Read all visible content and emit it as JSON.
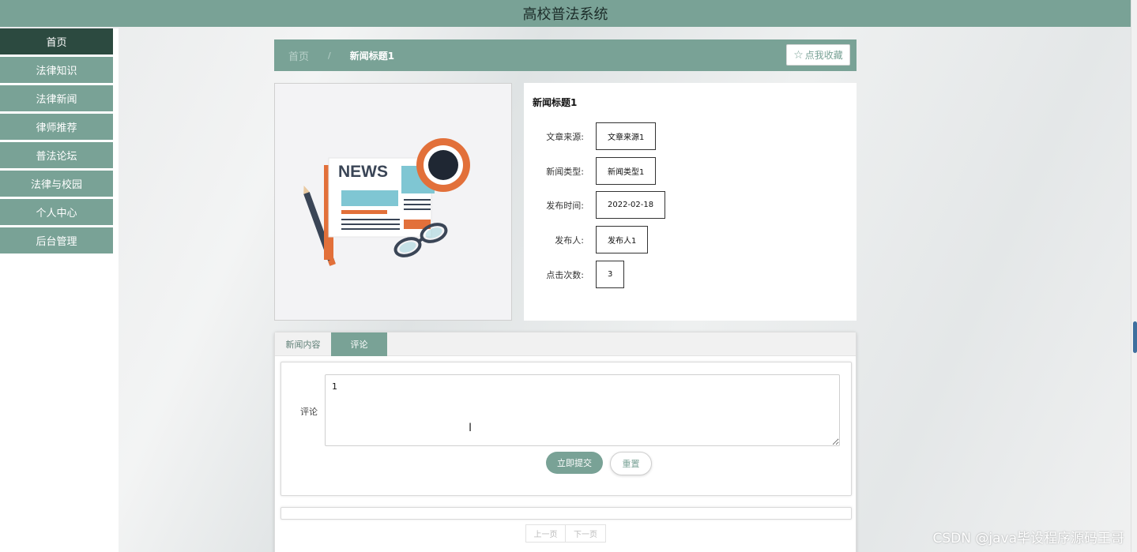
{
  "app": {
    "title": "高校普法系统"
  },
  "sidebar": {
    "items": [
      {
        "label": "首页"
      },
      {
        "label": "法律知识"
      },
      {
        "label": "法律新闻"
      },
      {
        "label": "律师推荐"
      },
      {
        "label": "普法论坛"
      },
      {
        "label": "法律与校园"
      },
      {
        "label": "个人中心"
      },
      {
        "label": "后台管理"
      }
    ]
  },
  "breadcrumb": {
    "home": "首页",
    "separator": "/",
    "current": "新闻标题1"
  },
  "favorite": {
    "icon": "star-outline-icon",
    "label": "点我收藏"
  },
  "image": {
    "headline_text": "NEWS"
  },
  "detail": {
    "title": "新闻标题1",
    "fields": [
      {
        "label": "文章来源:",
        "value": "文章来源1"
      },
      {
        "label": "新闻类型:",
        "value": "新闻类型1"
      },
      {
        "label": "发布时间:",
        "value": "2022-02-18"
      },
      {
        "label": "发布人:",
        "value": "发布人1"
      },
      {
        "label": "点击次数:",
        "value": "3"
      }
    ]
  },
  "tabs": [
    {
      "label": "新闻内容"
    },
    {
      "label": "评论"
    }
  ],
  "comment_form": {
    "label": "评论",
    "value": "1",
    "submit_label": "立即提交",
    "reset_label": "重置"
  },
  "pager": {
    "prev_label": "上一页",
    "next_label": "下一页"
  },
  "watermark": "CSDN @java毕设程序源码王哥",
  "colors": {
    "accent": "#79a296",
    "active_nav": "#2c4a40",
    "news_orange": "#e2703a",
    "news_teal": "#7fc6d3",
    "news_navy": "#3a4556"
  }
}
